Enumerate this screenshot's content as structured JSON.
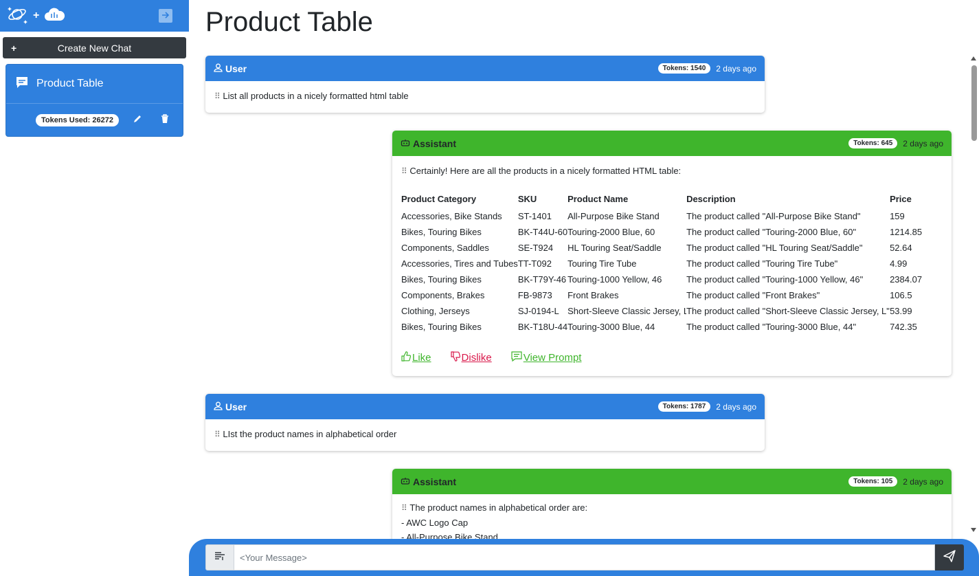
{
  "sidebar": {
    "logo_icons": [
      "planet-icon",
      "cloud-brain-icon"
    ],
    "collapse_icon": "arrow-right-icon",
    "new_chat_label": "Create New Chat",
    "chats": [
      {
        "title": "Product Table",
        "tokens_label": "Tokens Used: 26272"
      }
    ]
  },
  "page": {
    "title": "Product Table"
  },
  "messages": [
    {
      "role": "User",
      "tokens": "Tokens: 1540",
      "time": "2 days ago",
      "text": "List all products in a nicely formatted html table"
    },
    {
      "role": "Assistant",
      "tokens": "Tokens: 645",
      "time": "2 days ago",
      "text": "Certainly! Here are all the products in a nicely formatted HTML table:",
      "table": {
        "headers": [
          "Product Category",
          "SKU",
          "Product Name",
          "Description",
          "Price"
        ],
        "rows": [
          [
            "Accessories, Bike Stands",
            "ST-1401",
            "All-Purpose Bike Stand",
            "The product called \"All-Purpose Bike Stand\"",
            "159"
          ],
          [
            "Bikes, Touring Bikes",
            "BK-T44U-60",
            "Touring-2000 Blue, 60",
            "The product called \"Touring-2000 Blue, 60\"",
            "1214.85"
          ],
          [
            "Components, Saddles",
            "SE-T924",
            "HL Touring Seat/Saddle",
            "The product called \"HL Touring Seat/Saddle\"",
            "52.64"
          ],
          [
            "Accessories, Tires and Tubes",
            "TT-T092",
            "Touring Tire Tube",
            "The product called \"Touring Tire Tube\"",
            "4.99"
          ],
          [
            "Bikes, Touring Bikes",
            "BK-T79Y-46",
            "Touring-1000 Yellow, 46",
            "The product called \"Touring-1000 Yellow, 46\"",
            "2384.07"
          ],
          [
            "Components, Brakes",
            "FB-9873",
            "Front Brakes",
            "The product called \"Front Brakes\"",
            "106.5"
          ],
          [
            "Clothing, Jerseys",
            "SJ-0194-L",
            "Short-Sleeve Classic Jersey, L",
            "The product called \"Short-Sleeve Classic Jersey, L\"",
            "53.99"
          ],
          [
            "Bikes, Touring Bikes",
            "BK-T18U-44",
            "Touring-3000 Blue, 44",
            "The product called \"Touring-3000 Blue, 44\"",
            "742.35"
          ]
        ]
      },
      "actions": {
        "like": "Like",
        "dislike": "Dislike",
        "view_prompt": "View Prompt"
      }
    },
    {
      "role": "User",
      "tokens": "Tokens: 1787",
      "time": "2 days ago",
      "text": "LIst the product names in alphabetical order"
    },
    {
      "role": "Assistant",
      "tokens": "Tokens: 105",
      "time": "2 days ago",
      "text": "The product names in alphabetical order are:",
      "lines": [
        "- AWC Logo Cap",
        "- All-Purpose Bike Stand"
      ]
    }
  ],
  "composer": {
    "placeholder": "<Your Message>",
    "prefix_icon": "text-format-icon",
    "send_icon": "send-icon"
  },
  "colors": {
    "user_header": "#2f80de",
    "assistant_header": "#3fb52c",
    "dark_button": "#343a40",
    "dislike": "#d9184a"
  }
}
